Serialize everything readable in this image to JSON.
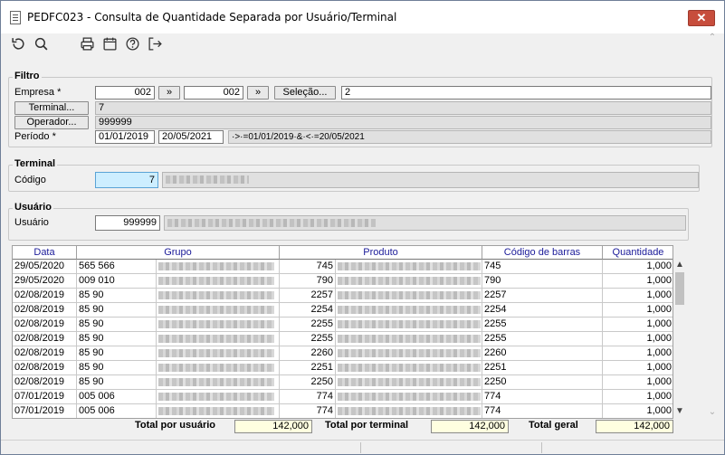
{
  "window": {
    "title": "PEDFC023 - Consulta de Quantidade Separada por Usuário/Terminal",
    "close_label": "✕"
  },
  "toolbar": {
    "icons": [
      "refresh-icon",
      "search-icon",
      "print-icon",
      "calendar-icon",
      "help-icon",
      "exit-icon"
    ]
  },
  "filtro": {
    "title": "Filtro",
    "empresa_label": "Empresa *",
    "empresa_from": "002",
    "empresa_to": "002",
    "range_btn_label": "»",
    "selecao_label": "Seleção...",
    "selecao_value": "2",
    "terminal_btn_label": "Terminal...",
    "terminal_value": "7",
    "operador_btn_label": "Operador...",
    "operador_value": "999999",
    "periodo_label": "Período *",
    "periodo_from": "01/01/2019",
    "periodo_to": "20/05/2021",
    "periodo_expr": "·>·=01/01/2019·&·<·=20/05/2021"
  },
  "terminal": {
    "title": "Terminal",
    "codigo_label": "Código",
    "codigo_value": "7"
  },
  "usuario": {
    "title": "Usuário",
    "usuario_label": "Usuário",
    "usuario_value": "999999"
  },
  "grid": {
    "columns": [
      "Data",
      "Grupo",
      "Produto",
      "Código de barras",
      "Quantidade"
    ],
    "rows": [
      {
        "data": "29/05/2020",
        "grupo": "565 566",
        "produto": "745",
        "barras": "745",
        "qtd": "1,000"
      },
      {
        "data": "29/05/2020",
        "grupo": "009 010",
        "produto": "790",
        "barras": "790",
        "qtd": "1,000"
      },
      {
        "data": "02/08/2019",
        "grupo": "85 90",
        "produto": "2257",
        "barras": "2257",
        "qtd": "1,000"
      },
      {
        "data": "02/08/2019",
        "grupo": "85 90",
        "produto": "2254",
        "barras": "2254",
        "qtd": "1,000"
      },
      {
        "data": "02/08/2019",
        "grupo": "85 90",
        "produto": "2255",
        "barras": "2255",
        "qtd": "1,000"
      },
      {
        "data": "02/08/2019",
        "grupo": "85 90",
        "produto": "2255",
        "barras": "2255",
        "qtd": "1,000"
      },
      {
        "data": "02/08/2019",
        "grupo": "85 90",
        "produto": "2260",
        "barras": "2260",
        "qtd": "1,000"
      },
      {
        "data": "02/08/2019",
        "grupo": "85 90",
        "produto": "2251",
        "barras": "2251",
        "qtd": "1,000"
      },
      {
        "data": "02/08/2019",
        "grupo": "85 90",
        "produto": "2250",
        "barras": "2250",
        "qtd": "1,000"
      },
      {
        "data": "07/01/2019",
        "grupo": "005 006",
        "produto": "774",
        "barras": "774",
        "qtd": "1,000"
      },
      {
        "data": "07/01/2019",
        "grupo": "005 006",
        "produto": "774",
        "barras": "774",
        "qtd": "1,000"
      }
    ]
  },
  "totals": {
    "usuario_label": "Total por usuário",
    "usuario_value": "142,000",
    "terminal_label": "Total por terminal",
    "terminal_value": "142,000",
    "geral_label": "Total geral",
    "geral_value": "142,000"
  },
  "colors": {
    "accent_header_text": "#1a1a99",
    "highlight_field": "#cdeeff",
    "close_button": "#c74d3c",
    "total_field": "#ffffe0"
  }
}
